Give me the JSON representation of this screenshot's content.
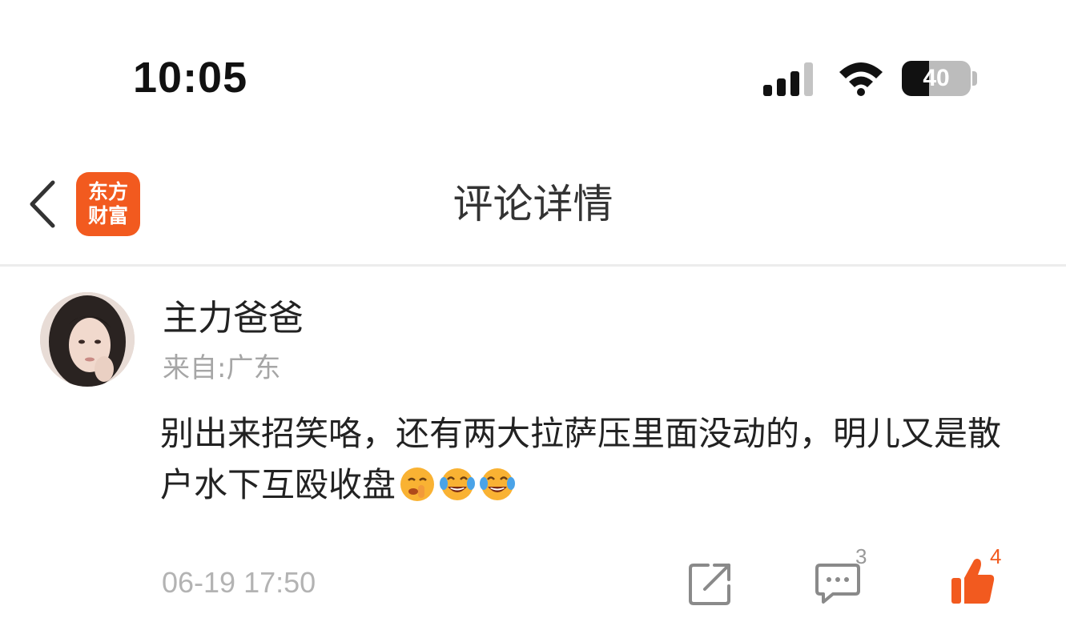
{
  "status_bar": {
    "time": "10:05",
    "battery_level": "40",
    "signal_icon": "cellular-signal-icon",
    "wifi_icon": "wifi-icon",
    "battery_icon": "battery-icon"
  },
  "nav": {
    "back_icon": "chevron-left-icon",
    "app_logo_line1": "东方",
    "app_logo_line2": "财富",
    "app_logo_color": "#f25a1f",
    "title": "评论详情"
  },
  "comment": {
    "username": "主力爸爸",
    "location": "来自:广东",
    "text": "别出来招笑咯，还有两大拉萨压里面没动的，明儿又是散户水下互殴收盘",
    "emojis": [
      "shushing-face-emoji",
      "tears-of-joy-emoji",
      "tears-of-joy-emoji"
    ],
    "timestamp": "06-19 17:50",
    "comment_count": "3",
    "like_count": "4",
    "accent_color": "#f25a1f"
  }
}
